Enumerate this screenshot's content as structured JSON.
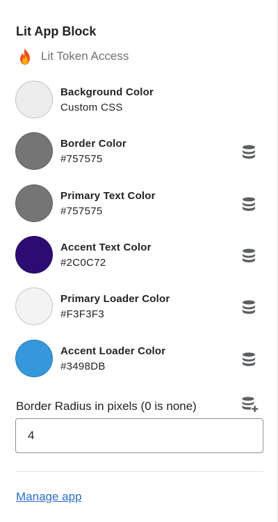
{
  "block": {
    "title": "Lit App Block",
    "app_name": "Lit Token Access",
    "app_icon": "fire-icon"
  },
  "settings": [
    {
      "label": "Background Color",
      "value": "Custom CSS",
      "swatch": "#EEEDEE",
      "has_source_icon": false
    },
    {
      "label": "Border Color",
      "value": "#757575",
      "swatch": "#757575",
      "has_source_icon": true
    },
    {
      "label": "Primary Text Color",
      "value": "#757575",
      "swatch": "#757575",
      "has_source_icon": true
    },
    {
      "label": "Accent Text Color",
      "value": "#2C0C72",
      "swatch": "#2C0C72",
      "has_source_icon": true
    },
    {
      "label": "Primary Loader Color",
      "value": "#F3F3F3",
      "swatch": "#F3F3F3",
      "has_source_icon": true
    },
    {
      "label": "Accent Loader Color",
      "value": "#3498DB",
      "swatch": "#3498DB",
      "has_source_icon": true
    }
  ],
  "border_radius": {
    "label": "Border Radius in pixels (0 is none)",
    "value": "4",
    "icon": "database-plus-icon"
  },
  "footer": {
    "manage_link": "Manage app"
  },
  "colors": {
    "link": "#2C6ECB",
    "icon": "#5C5F62",
    "divider": "#E1E3E5"
  }
}
